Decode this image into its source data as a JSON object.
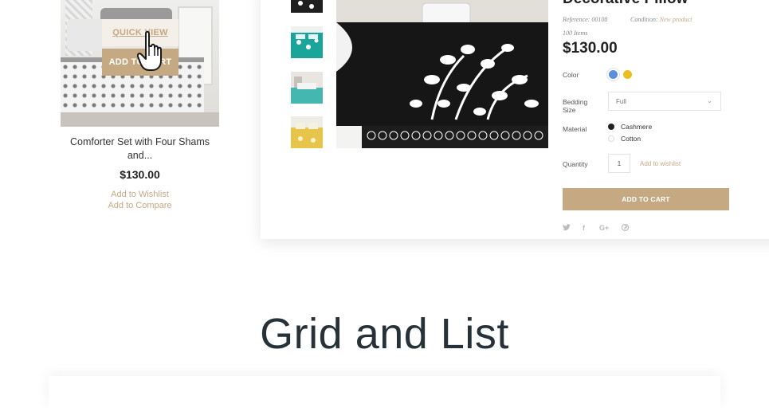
{
  "product_card": {
    "quick_view_label": "QUICK VIEW",
    "add_to_cart_label": "ADD TO CART",
    "title": "Comforter Set with Four Shams and...",
    "price": "$130.00",
    "add_to_wishlist": "Add to Wishlist",
    "add_to_compare": "Add to Compare"
  },
  "quick_view": {
    "title": "Decorative Pillow",
    "reference_label": "Reference:",
    "reference_value": "00108",
    "condition_label": "Condition:",
    "condition_value": "New product",
    "stock": "100 Items",
    "price": "$130.00",
    "color_label": "Color",
    "colors": [
      "#5b8fde",
      "#e9be1e"
    ],
    "bedding_size_label": "Bedding Size",
    "bedding_size_value": "Full",
    "material_label": "Material",
    "materials": [
      {
        "label": "Cashmere",
        "selected": true
      },
      {
        "label": "Cotton",
        "selected": false
      }
    ],
    "quantity_label": "Quantity",
    "quantity_value": "1",
    "wishlist_link": "Add to wishlist",
    "add_to_cart_label": "ADD TO CART",
    "social_icons": [
      "twitter-icon",
      "facebook-icon",
      "google-plus-icon",
      "pinterest-icon"
    ],
    "social_glyphs": [
      "🐦",
      "f",
      "G+",
      "℗"
    ],
    "thumbnails": [
      "black-floral-bedding",
      "teal-bedding",
      "teal-bedroom",
      "yellow-bedding"
    ]
  },
  "section": {
    "title": "Grid and List"
  },
  "colors": {
    "accent": "#c4a983",
    "heading": "#263238"
  }
}
